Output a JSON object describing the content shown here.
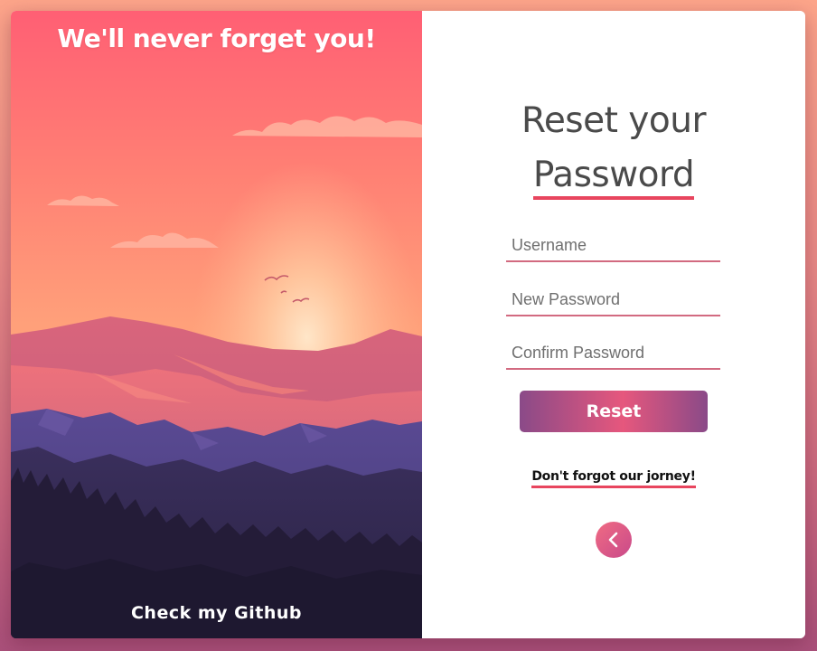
{
  "left_panel": {
    "title": "We'll never forget you!",
    "github_link": "Check my Github"
  },
  "form": {
    "heading_line1": "Reset your",
    "heading_line2": "Password",
    "username_placeholder": "Username",
    "new_password_placeholder": "New Password",
    "confirm_password_placeholder": "Confirm Password",
    "reset_label": "Reset",
    "journey_link": "Don't forgot our jorney!",
    "back_icon": "chevron-left-icon"
  },
  "colors": {
    "accent": "#e8455e",
    "button_gradient_start": "#8a4a88",
    "button_gradient_mid": "#e6577d",
    "heading": "#4a4a4a"
  }
}
